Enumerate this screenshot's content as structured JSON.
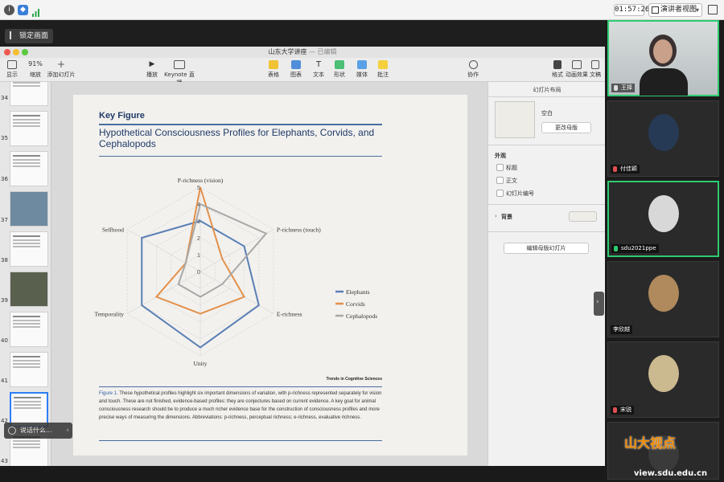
{
  "meeting": {
    "clock": "01:57:26",
    "presenter_view_label": "演讲者视图",
    "lock_screen_label": "锁定画面",
    "speaking_label": "说话什么..."
  },
  "keynote": {
    "window_title": "山东大学讲座",
    "edit_status": "— 已编辑",
    "toolbar": {
      "view": "显示",
      "zoom_value": "91%",
      "zoom": "缩放",
      "add_slide": "添加幻灯片",
      "play": "播放",
      "keynote_live": "Keynote 直播",
      "table": "表格",
      "chart": "图表",
      "text": "文本",
      "shape": "形状",
      "media": "媒体",
      "comment": "批注",
      "collaborate": "协作",
      "format": "格式",
      "animate": "动画效果",
      "document": "文稿"
    },
    "slide_numbers": [
      "34",
      "35",
      "36",
      "37",
      "38",
      "39",
      "40",
      "41",
      "42",
      "43"
    ],
    "inspector": {
      "title": "幻灯片布局",
      "master_name": "空白",
      "change_master": "更改母版",
      "appearance": "外观",
      "opt_title": "标题",
      "opt_body": "正文",
      "opt_number": "幻灯片编号",
      "background": "背景",
      "edit_master": "编辑母版幻灯片"
    }
  },
  "slide": {
    "heading": "Key Figure",
    "title": "Hypothetical Consciousness Profiles for Elephants, Corvids, and Cephalopods",
    "source": "Trends in Cognitive Sciences",
    "caption_label": "Figure 1.",
    "caption": "These hypothetical profiles highlight six important dimensions of variation, with p-richness represented separately for vision and touch. These are not finished, evidence-based profiles: they are conjectures based on current evidence. A key goal for animal consciousness research should be to produce a much richer evidence base for the construction of consciousness profiles and more precise ways of measuring the dimensions. Abbreviations: p-richness, perceptual richness; e-richness, evaluative richness."
  },
  "chart_data": {
    "type": "radar",
    "title": "Hypothetical Consciousness Profiles for Elephants, Corvids, and Cephalopods",
    "axes": [
      "P-richness (vision)",
      "P-richness (touch)",
      "E-richness",
      "Unity",
      "Temporality",
      "Selfhood"
    ],
    "rlim": [
      0,
      5
    ],
    "ticks": [
      0,
      1,
      2,
      3,
      4,
      5
    ],
    "legend_position": "right",
    "series": [
      {
        "name": "Elephants",
        "color": "#5a7fb5",
        "values": [
          3,
          3,
          4,
          4.5,
          4,
          4
        ]
      },
      {
        "name": "Corvids",
        "color": "#e3904a",
        "values": [
          5,
          1.5,
          3,
          2.5,
          3,
          1
        ]
      },
      {
        "name": "Cephalopods",
        "color": "#a8a8a8",
        "values": [
          4,
          4.5,
          1.5,
          1.5,
          1.5,
          1
        ]
      }
    ]
  },
  "participants": [
    {
      "name": "王择",
      "avatar_color": "#7a8a90",
      "is_video": true
    },
    {
      "name": "付佳颖",
      "avatar_color": "#263a55",
      "is_video": false
    },
    {
      "name": "sdu2021ppe",
      "avatar_color": "#d8d8d8",
      "is_video": false
    },
    {
      "name": "李欣越",
      "avatar_color": "#b08a5c",
      "is_video": false
    },
    {
      "name": "宋锐",
      "avatar_color": "#cbb98f",
      "is_video": false
    },
    {
      "name": "",
      "avatar_color": "#3a3a3a",
      "is_video": false
    }
  ],
  "watermark": {
    "brand": "山大视点",
    "url": "view.sdu.edu.cn"
  }
}
